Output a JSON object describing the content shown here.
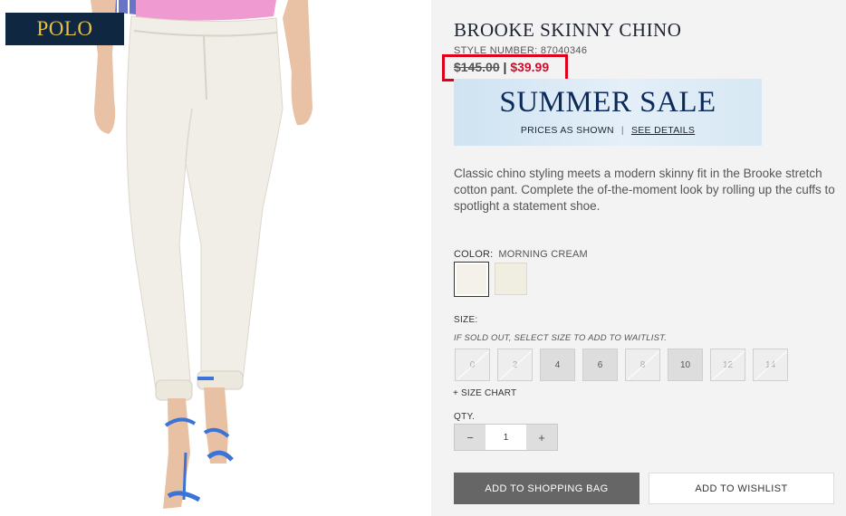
{
  "logo": {
    "text": "POLO"
  },
  "product": {
    "title": "BROOKE SKINNY CHINO",
    "style_label": "STYLE NUMBER:",
    "style_number": "87040346",
    "price_original": "$145.00",
    "price_separator": "|",
    "price_sale": "$39.99",
    "description": "Classic chino styling meets a modern skinny fit in the Brooke stretch cotton pant. Complete the of-the-moment look by rolling up the cuffs to spotlight a statement shoe."
  },
  "banner": {
    "headline": "SUMMER SALE",
    "prices_as_shown": "PRICES AS SHOWN",
    "separator": "|",
    "see_details": "SEE DETAILS"
  },
  "color": {
    "label": "COLOR:",
    "selected": "MORNING CREAM",
    "swatch_colors": [
      "#f4f1ea",
      "#f0eee0"
    ]
  },
  "size": {
    "label": "SIZE:",
    "note": "IF SOLD OUT, SELECT SIZE TO ADD TO WAITLIST.",
    "options": [
      {
        "label": "0",
        "sold_out": true
      },
      {
        "label": "2",
        "sold_out": true
      },
      {
        "label": "4",
        "sold_out": false
      },
      {
        "label": "6",
        "sold_out": false
      },
      {
        "label": "8",
        "sold_out": true
      },
      {
        "label": "10",
        "sold_out": false
      },
      {
        "label": "12",
        "sold_out": true
      },
      {
        "label": "14",
        "sold_out": true
      }
    ],
    "chart_link": "+ SIZE CHART"
  },
  "quantity": {
    "label": "QTY.",
    "value": "1",
    "minus": "−",
    "plus": "+"
  },
  "actions": {
    "add_to_bag": "ADD TO SHOPPING BAG",
    "add_to_wishlist": "ADD TO WISHLIST"
  },
  "colors": {
    "sale_red": "#c8102e",
    "highlight_red": "#e1001a",
    "navy": "#0f2741",
    "logo_gold": "#e8c04a"
  }
}
